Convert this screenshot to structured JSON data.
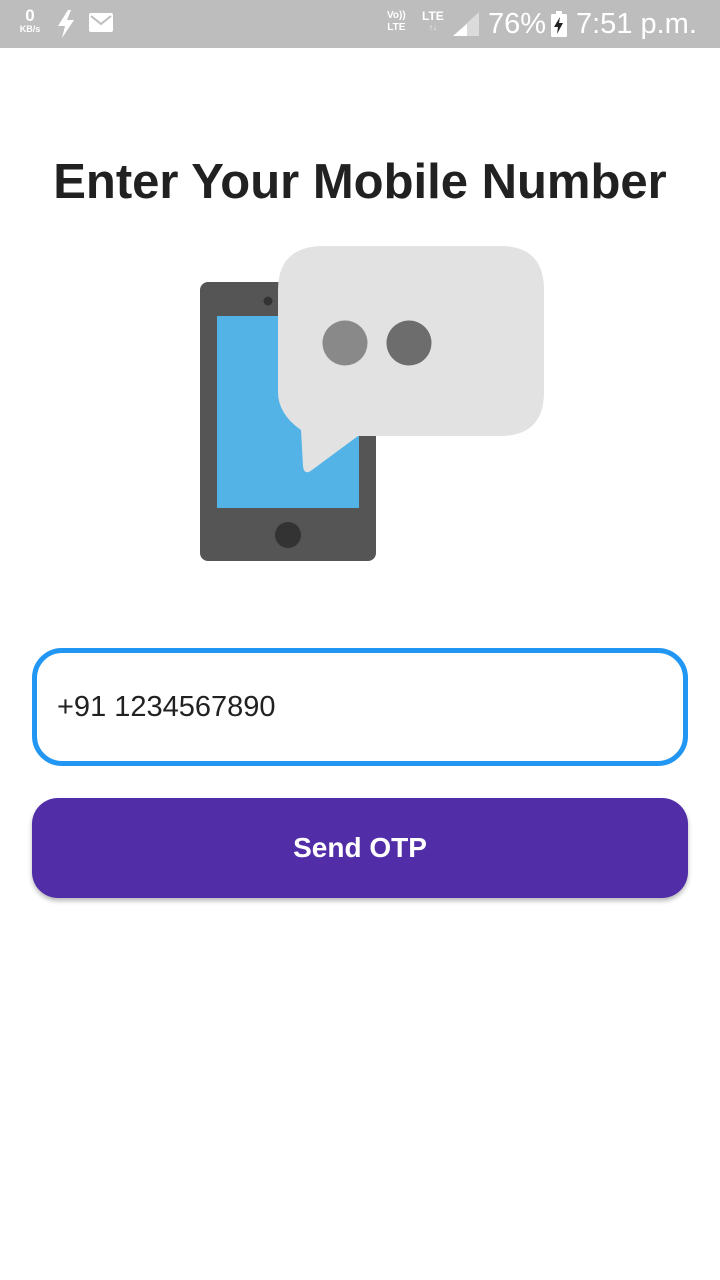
{
  "status_bar": {
    "net_speed_value": "0",
    "net_speed_unit": "KB/s",
    "volte_top": "Vo))",
    "volte_bottom": "LTE",
    "lte_label": "LTE",
    "lte_arrows": "↑↓",
    "battery_percent": "76%",
    "time": "7:51 p.m.",
    "icons": [
      "flash-icon",
      "mail-icon",
      "signal-icon",
      "battery-charging-icon"
    ]
  },
  "page": {
    "title": "Enter Your Mobile Number"
  },
  "illustration": {
    "icon": "phone-chat-illustration",
    "colors": {
      "phone_body": "#555555",
      "phone_screen": "#54b3e6",
      "bubble": "#e2e2e2",
      "dot_light": "#898989",
      "dot_dark": "#6d6d6d"
    }
  },
  "form": {
    "phone_value": "+91 1234567890",
    "send_button_label": "Send OTP"
  },
  "colors": {
    "status_bar": "#bdbdbd",
    "input_border": "#2196f3",
    "button_bg": "#512da8",
    "title_text": "#212121"
  }
}
